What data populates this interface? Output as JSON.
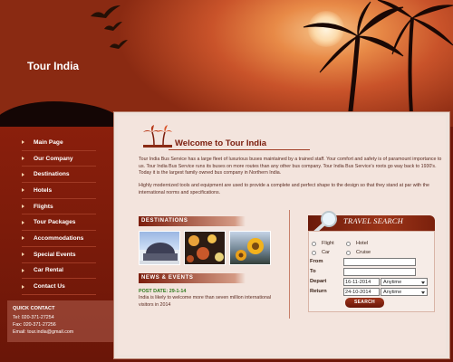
{
  "site": {
    "title": "Tour India"
  },
  "nav": [
    {
      "label": "Main Page"
    },
    {
      "label": "Our Company"
    },
    {
      "label": "Destinations"
    },
    {
      "label": "Hotels"
    },
    {
      "label": "Flights"
    },
    {
      "label": "Tour Packages"
    },
    {
      "label": "Accommodations"
    },
    {
      "label": "Special Events"
    },
    {
      "label": "Car Rental"
    },
    {
      "label": "Contact Us"
    }
  ],
  "quick_contact": {
    "title": "QUICK CONTACT",
    "tel": "Tel: 020-371-27254",
    "fax": "Fax: 020-371-27256",
    "email": "Email: tour.india@gmail.com"
  },
  "welcome": {
    "title": "Welcome to Tour India",
    "paragraph1": "Tour India Bus Service has a large fleet of luxurious buses maintained by a trained staff. Your comfort and safety is of paramount importance to us. Tour India Bus Service runs its buses on more routes than any other bus company. Tour India Bus Service's roots go way back to 1930's. Today it is the largest family owned bus company in Northern India.",
    "paragraph2": "Highly modernized tools and equipment are used to provide a complete and perfect shape to the design so that they stand at par with the international norms and specifications."
  },
  "destinations": {
    "heading": "DESTINATIONS"
  },
  "news": {
    "heading": "NEWS & EVENTS",
    "post_date": "POST DATE: 29-1-14",
    "text": "India is likely to welcome more than seven million international visitors in 2014"
  },
  "travel_search": {
    "title": "TRAVEL SEARCH",
    "options": {
      "flight": "Flight",
      "hotel": "Hotel",
      "car": "Car",
      "cruise": "Cruise"
    },
    "from_label": "From",
    "to_label": "To",
    "from_value": "",
    "to_value": "",
    "depart_label": "Depart",
    "return_label": "Return",
    "depart_date": "16-11-2014",
    "return_date": "24-10-2014",
    "depart_time": "Anytime",
    "return_time": "Anytime",
    "button": "SEARCH"
  },
  "colors": {
    "accent": "#7a1c0c",
    "sidebar": "#7a1a0a",
    "panel": "#f3e4dd",
    "news_date": "#2d7a1c"
  }
}
